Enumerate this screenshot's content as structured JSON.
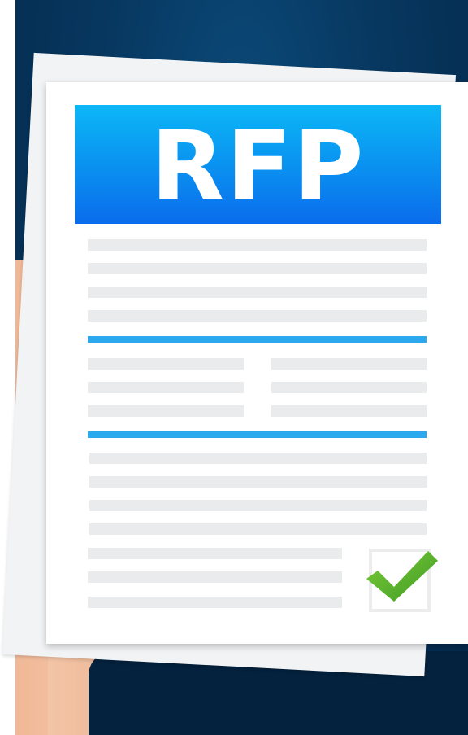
{
  "document": {
    "title": "RFP"
  },
  "colors": {
    "background": "#07375f",
    "banner": "#0a8ff0",
    "rule": "#2ba8ee",
    "checkmark": "#5fb82e",
    "skin": "#f0b896"
  },
  "icons": {
    "checkmark": "check-icon",
    "checkbox": "checkbox-icon"
  }
}
